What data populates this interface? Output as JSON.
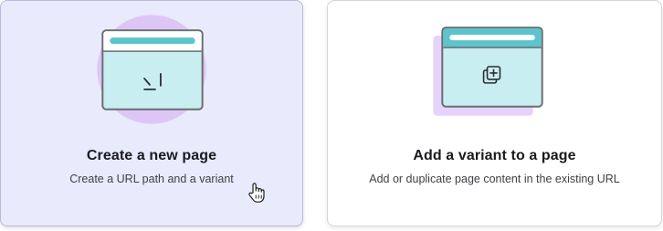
{
  "cards": [
    {
      "title": "Create a new page",
      "description": "Create a URL path and a variant",
      "icon": "new-page-illustration",
      "selected": true
    },
    {
      "title": "Add a variant to a page",
      "description": "Add or duplicate page content in the existing URL",
      "icon": "add-variant-illustration",
      "selected": false
    }
  ],
  "colors": {
    "selected_card_bg": "#e9eafc",
    "window_fill": "#c8eef2",
    "window_bar": "#5bc4cd",
    "accent_circle": "#ddc6f6",
    "shadow_square": "#e6d3f9",
    "outline": "#6b6c70"
  }
}
